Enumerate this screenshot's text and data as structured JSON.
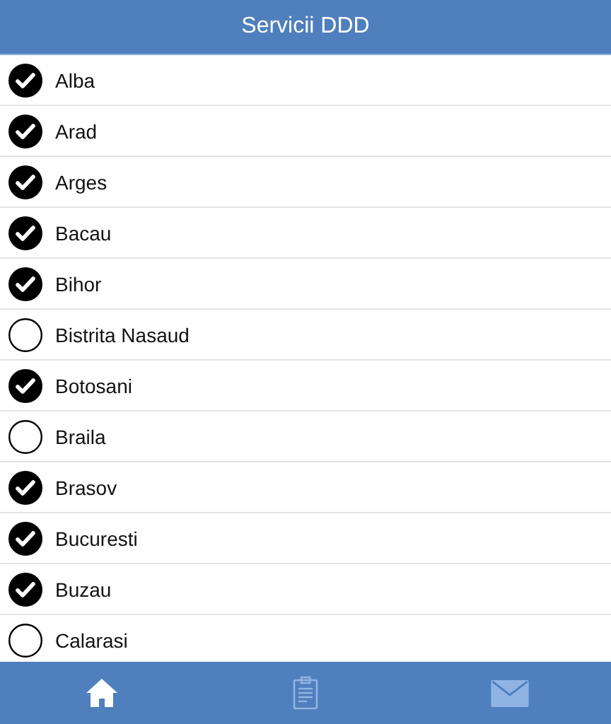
{
  "header": {
    "title": "Servicii DDD"
  },
  "items": [
    {
      "label": "Alba",
      "checked": true
    },
    {
      "label": "Arad",
      "checked": true
    },
    {
      "label": "Arges",
      "checked": true
    },
    {
      "label": "Bacau",
      "checked": true
    },
    {
      "label": "Bihor",
      "checked": true
    },
    {
      "label": "Bistrita Nasaud",
      "checked": false
    },
    {
      "label": "Botosani",
      "checked": true
    },
    {
      "label": "Braila",
      "checked": false
    },
    {
      "label": "Brasov",
      "checked": true
    },
    {
      "label": "Bucuresti",
      "checked": true
    },
    {
      "label": "Buzau",
      "checked": true
    },
    {
      "label": "Calarasi",
      "checked": false
    }
  ],
  "tabs": [
    {
      "kind": "home",
      "selected": true
    },
    {
      "kind": "clipboard",
      "selected": false
    },
    {
      "kind": "mail",
      "selected": false
    }
  ]
}
